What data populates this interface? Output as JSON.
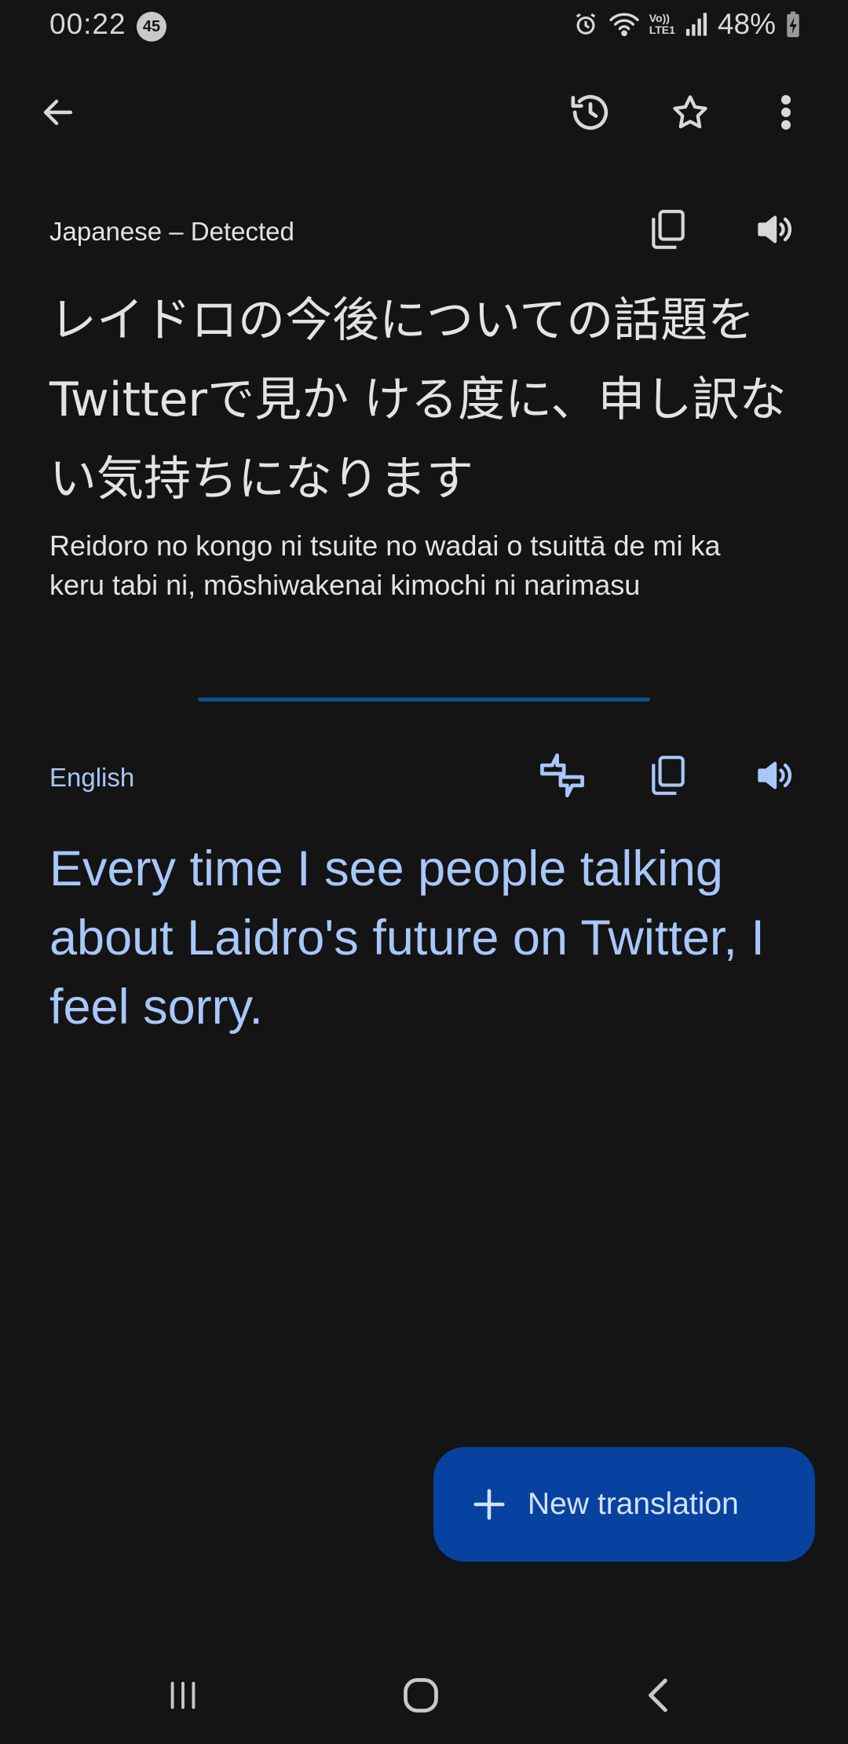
{
  "status_bar": {
    "time": "00:22",
    "notification_count": "45",
    "volte_line1": "Vo))",
    "volte_line2": "LTE1",
    "battery": "48%"
  },
  "source": {
    "language_label": "Japanese – Detected",
    "text": "レイドロの今後についての話題をTwitterで見か ける度に、申し訳ない気持ちになります",
    "romanization": "Reidoro no kongo ni tsuite no wadai o tsuittā de mi ka keru tabi ni, mōshiwakenai kimochi ni narimasu"
  },
  "target": {
    "language_label": "English",
    "text": "Every time I see people talking about Laidro's future on Twitter, I feel sorry."
  },
  "fab": {
    "label": "New translation"
  },
  "colors": {
    "background": "#141414",
    "accent_text": "#a8c7fa",
    "fab_background": "#0842a0",
    "divider": "#0b4f8a"
  }
}
